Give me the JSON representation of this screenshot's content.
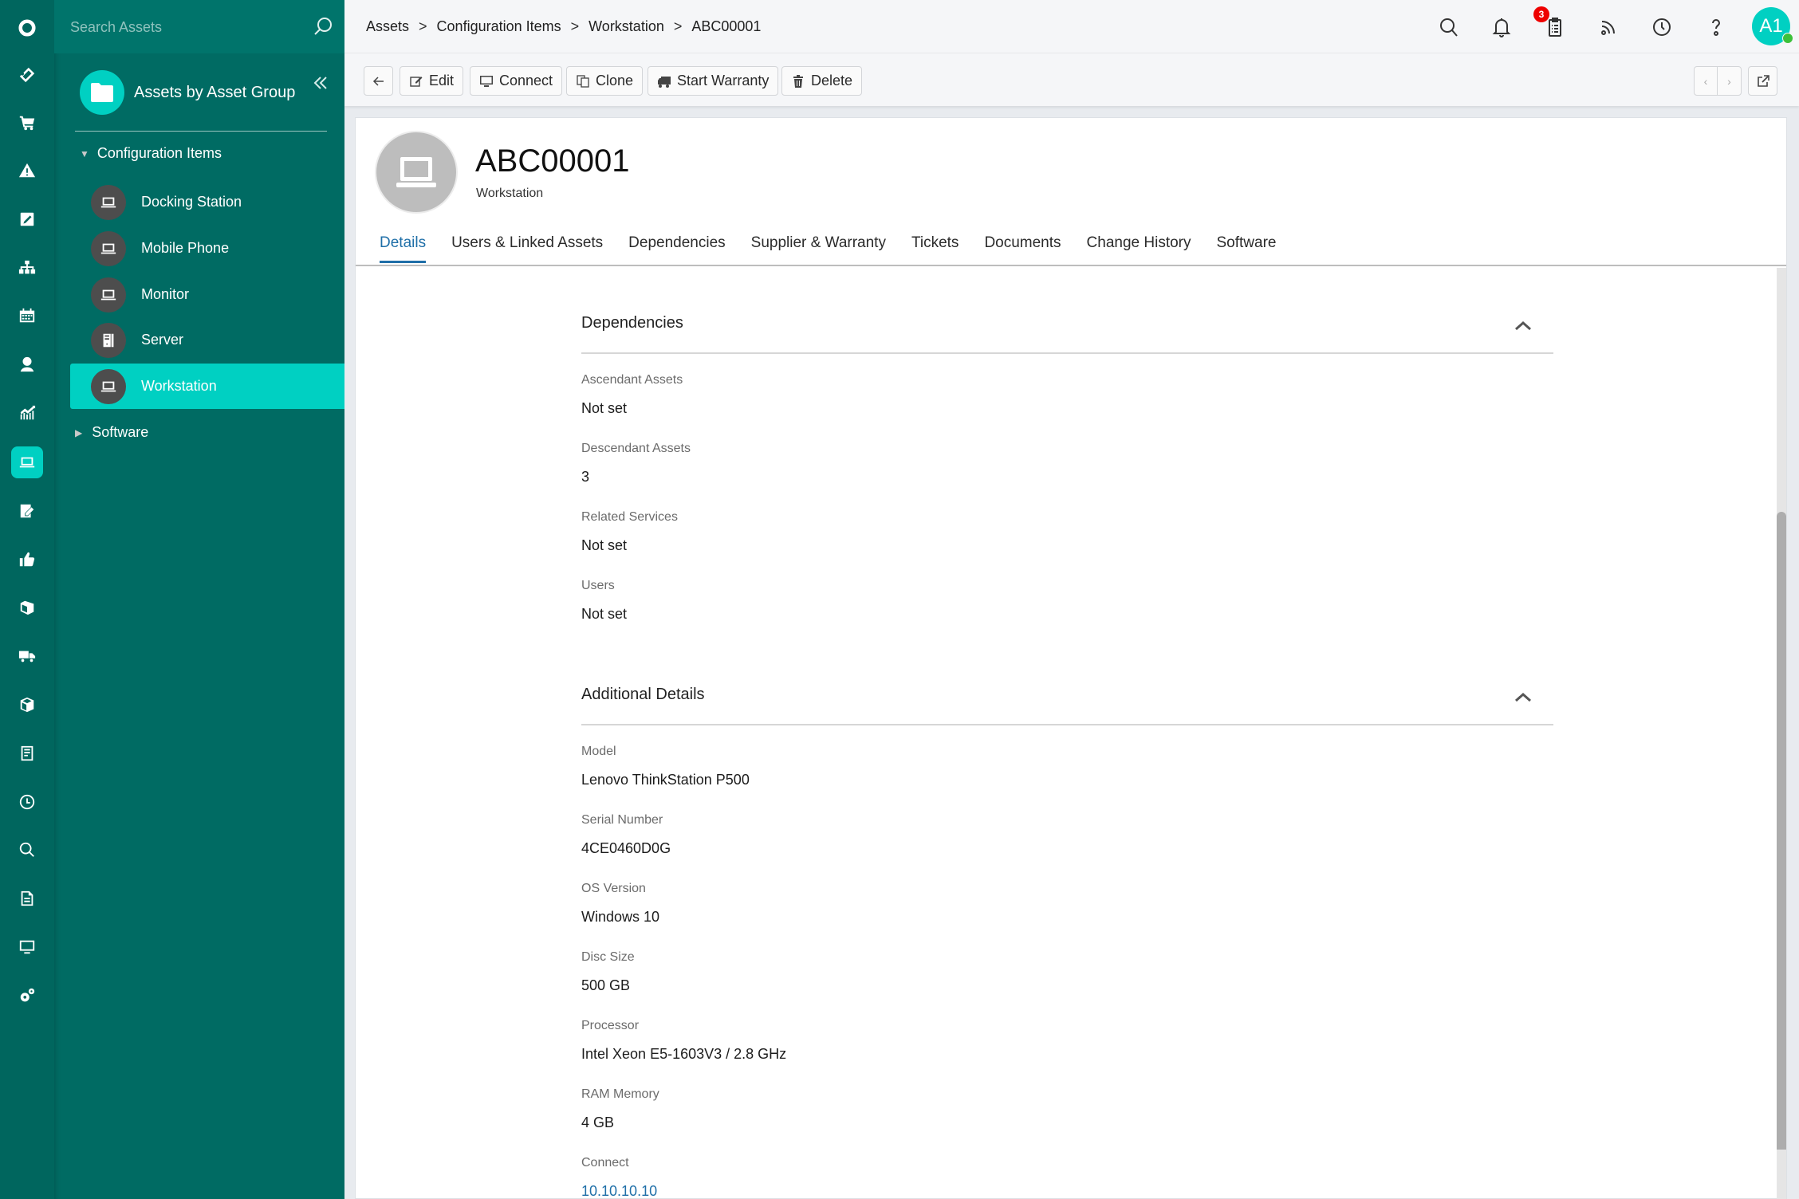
{
  "rail": {
    "items": [
      {
        "name": "logo-icon"
      },
      {
        "name": "ticket-icon"
      },
      {
        "name": "cart-icon"
      },
      {
        "name": "warning-icon"
      },
      {
        "name": "edit-icon"
      },
      {
        "name": "hierarchy-icon"
      },
      {
        "name": "calendar-icon"
      },
      {
        "name": "user-idea-icon"
      },
      {
        "name": "chart-icon"
      },
      {
        "name": "laptop-icon",
        "active": true
      },
      {
        "name": "note-edit-icon"
      },
      {
        "name": "thumbs-up-icon"
      },
      {
        "name": "books-icon"
      },
      {
        "name": "truck-icon"
      },
      {
        "name": "box-icon"
      },
      {
        "name": "document-list-icon"
      },
      {
        "name": "clock-icon"
      },
      {
        "name": "search-icon"
      },
      {
        "name": "file-icon"
      },
      {
        "name": "monitor-icon"
      },
      {
        "name": "settings-icon"
      }
    ]
  },
  "sidebar": {
    "search_placeholder": "Search Assets",
    "group_title": "Assets by Asset Group",
    "tree": {
      "root_label": "Configuration Items",
      "items": [
        {
          "label": "Docking Station",
          "icon": "laptop-icon"
        },
        {
          "label": "Mobile Phone",
          "icon": "laptop-icon"
        },
        {
          "label": "Monitor",
          "icon": "laptop-icon"
        },
        {
          "label": "Server",
          "icon": "server-icon"
        },
        {
          "label": "Workstation",
          "icon": "laptop-icon",
          "active": true
        }
      ],
      "second_root_label": "Software"
    }
  },
  "header": {
    "breadcrumbs": [
      "Assets",
      "Configuration Items",
      "Workstation",
      "ABC00001"
    ],
    "separator": ">",
    "notification_badge": "3",
    "avatar_initials": "A1"
  },
  "toolbar": {
    "edit_label": "Edit",
    "connect_label": "Connect",
    "clone_label": "Clone",
    "start_warranty_label": "Start Warranty",
    "delete_label": "Delete",
    "prev_glyph": "‹",
    "next_glyph": "›"
  },
  "asset": {
    "title": "ABC00001",
    "subtitle": "Workstation"
  },
  "tabs": [
    {
      "label": "Details",
      "active": true
    },
    {
      "label": "Users & Linked Assets"
    },
    {
      "label": "Dependencies"
    },
    {
      "label": "Supplier & Warranty"
    },
    {
      "label": "Tickets"
    },
    {
      "label": "Documents"
    },
    {
      "label": "Change History"
    },
    {
      "label": "Software"
    }
  ],
  "sections": {
    "dependencies": {
      "title": "Dependencies",
      "fields": [
        {
          "label": "Ascendant Assets",
          "value": "Not set"
        },
        {
          "label": "Descendant Assets",
          "value": "3"
        },
        {
          "label": "Related Services",
          "value": "Not set"
        },
        {
          "label": "Users",
          "value": "Not set"
        }
      ]
    },
    "additional": {
      "title": "Additional Details",
      "fields": [
        {
          "label": "Model",
          "value": "Lenovo ThinkStation P500"
        },
        {
          "label": "Serial Number",
          "value": "4CE0460D0G"
        },
        {
          "label": "OS Version",
          "value": "Windows 10"
        },
        {
          "label": "Disc Size",
          "value": "500 GB"
        },
        {
          "label": "Processor",
          "value": "Intel Xeon E5-1603V3 / 2.8 GHz"
        },
        {
          "label": "RAM Memory",
          "value": "4 GB"
        },
        {
          "label": "Connect",
          "value": "10.10.10.10",
          "link": true
        }
      ]
    }
  },
  "colors": {
    "rail": "#00665e",
    "sidebar": "#006b63",
    "accent": "#00d0c2",
    "link": "#1f6fa8",
    "badge": "#ee0000",
    "online": "#3cc13b"
  }
}
